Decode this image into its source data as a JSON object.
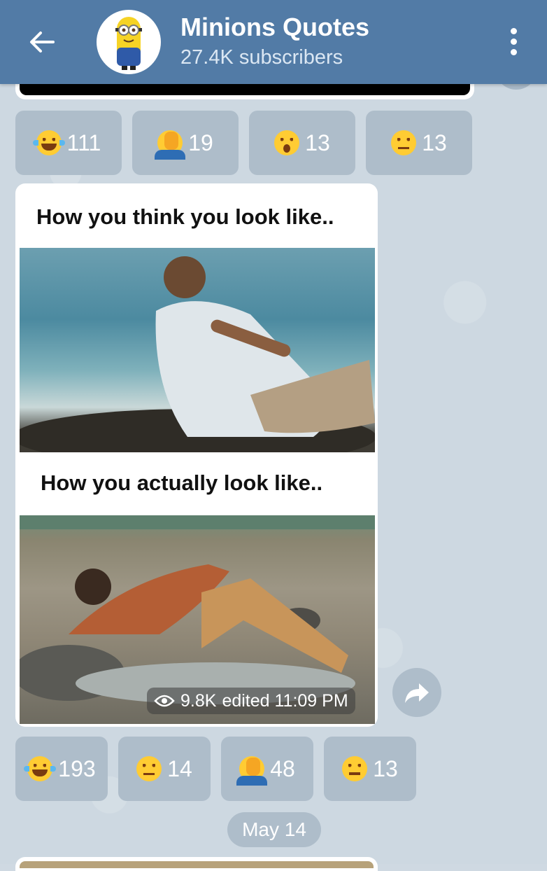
{
  "header": {
    "title": "Minions Quotes",
    "subtitle": "27.4K subscribers",
    "back_icon": "arrow-left-icon",
    "menu_icon": "more-vertical-icon",
    "avatar": "minion-avatar"
  },
  "reactions_top": [
    {
      "emoji": "joy",
      "count": "111"
    },
    {
      "emoji": "facepalm",
      "count": "19"
    },
    {
      "emoji": "hushed",
      "count": "13"
    },
    {
      "emoji": "unamused",
      "count": "13"
    }
  ],
  "post": {
    "caption_top": "How you think you look like..",
    "caption_bottom": "How you actually look like..",
    "views": "9.8K",
    "edited_time": "edited 11:09 PM"
  },
  "reactions_bottom": [
    {
      "emoji": "joy",
      "count": "193"
    },
    {
      "emoji": "unamused",
      "count": "14"
    },
    {
      "emoji": "facepalm",
      "count": "48"
    },
    {
      "emoji": "neutral",
      "count": "13"
    }
  ],
  "date_separator": "May 14",
  "colors": {
    "header": "#527ba6",
    "chip": "#aebdca",
    "background": "#cdd8e1"
  }
}
